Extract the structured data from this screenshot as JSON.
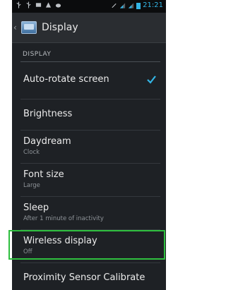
{
  "status_bar": {
    "time": "21:21",
    "icons": [
      "usb-icon",
      "usb-debug-icon",
      "image-icon",
      "warning-icon",
      "cat-icon",
      "mute-icon",
      "signal-icon",
      "signal-icon",
      "battery-icon"
    ]
  },
  "action_bar": {
    "title": "Display"
  },
  "section": {
    "header": "DISPLAY"
  },
  "settings": [
    {
      "title": "Auto-rotate screen",
      "checked": true
    },
    {
      "title": "Brightness"
    },
    {
      "title": "Daydream",
      "subtitle": "Clock"
    },
    {
      "title": "Font size",
      "subtitle": "Large"
    },
    {
      "title": "Sleep",
      "subtitle": "After 1 minute of inactivity"
    },
    {
      "title": "Wireless display",
      "subtitle": "Off"
    },
    {
      "title": "Proximity Sensor Calibrate"
    }
  ],
  "colors": {
    "accent": "#33b5e5",
    "highlight": "#2fbf3f",
    "background": "#1e2125"
  }
}
